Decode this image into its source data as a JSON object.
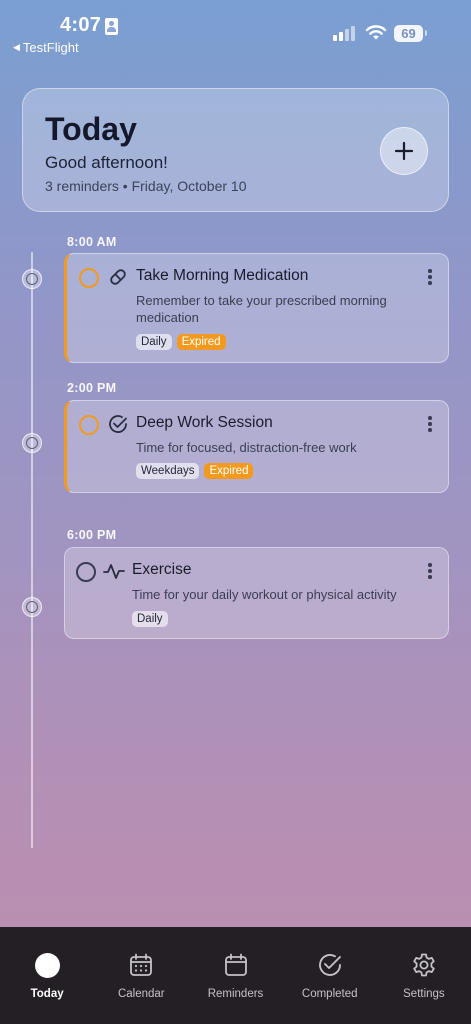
{
  "status_bar": {
    "time": "4:07",
    "back_app": "TestFlight",
    "battery": "69",
    "icons": [
      "person-badge-icon",
      "cellular-signal-icon",
      "wifi-icon",
      "battery-icon"
    ]
  },
  "header": {
    "title": "Today",
    "greeting": "Good afternoon!",
    "meta": "3 reminders • Friday, October 10",
    "add_icon": "plus-icon"
  },
  "reminders": [
    {
      "time": "8:00 AM",
      "title": "Take Morning Medication",
      "description": "Remember to take your prescribed morning medication",
      "tags": [
        "Daily",
        "Expired"
      ],
      "icon": "pill-icon",
      "status_color": "#f39a1e"
    },
    {
      "time": "2:00 PM",
      "title": "Deep Work Session",
      "description": "Time for focused, distraction-free work",
      "tags": [
        "Weekdays",
        "Expired"
      ],
      "icon": "check-circle-icon",
      "status_color": "#f39a1e"
    },
    {
      "time": "6:00 PM",
      "title": "Exercise",
      "description": "Time for your daily workout or physical activity",
      "tags": [
        "Daily"
      ],
      "icon": "activity-icon",
      "status_color": "#3a3d52"
    }
  ],
  "tab_bar": {
    "items": [
      {
        "label": "Today",
        "icon": "today-dot-icon",
        "active": true
      },
      {
        "label": "Calendar",
        "icon": "calendar-grid-icon",
        "active": false
      },
      {
        "label": "Reminders",
        "icon": "calendar-icon",
        "active": false
      },
      {
        "label": "Completed",
        "icon": "check-circle-icon",
        "active": false
      },
      {
        "label": "Settings",
        "icon": "gear-icon",
        "active": false
      }
    ],
    "background": "#241f24"
  },
  "colors": {
    "accent_expired": "#f39a1e",
    "background_top": "#7a9fd1",
    "background_bottom": "#bd8fae"
  }
}
